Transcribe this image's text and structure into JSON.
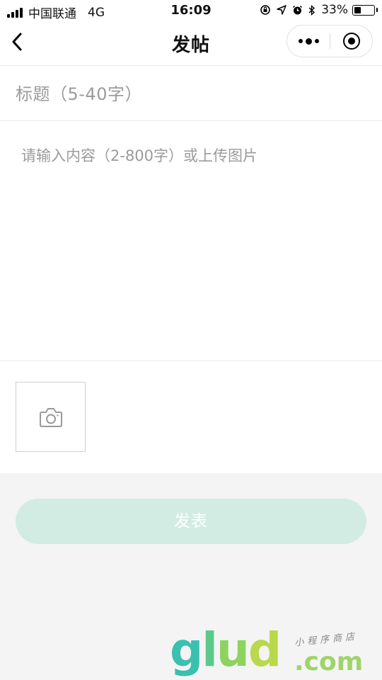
{
  "status_bar": {
    "carrier": "中国联通",
    "network": "4G",
    "time": "16:09",
    "battery": "33%",
    "battery_level": 0.33
  },
  "nav": {
    "title": "发帖"
  },
  "form": {
    "title_placeholder": "标题（5-40字）",
    "content_placeholder": "请输入内容（2-800字）或上传图片",
    "submit_label": "发表"
  },
  "watermark": {
    "brand": [
      "g",
      "l",
      "u",
      "d"
    ],
    "domain": ".com",
    "slogan": "小程序商店"
  },
  "colors": {
    "submit_bg": "#d2ece4",
    "brand_teal": "#3bbfae",
    "brand_green": "#8dd35f"
  },
  "icons": [
    "signal-icon",
    "orientation-lock-icon",
    "location-icon",
    "alarm-icon",
    "bluetooth-icon",
    "battery-icon",
    "back-icon",
    "more-icon",
    "close-target-icon",
    "camera-icon"
  ]
}
